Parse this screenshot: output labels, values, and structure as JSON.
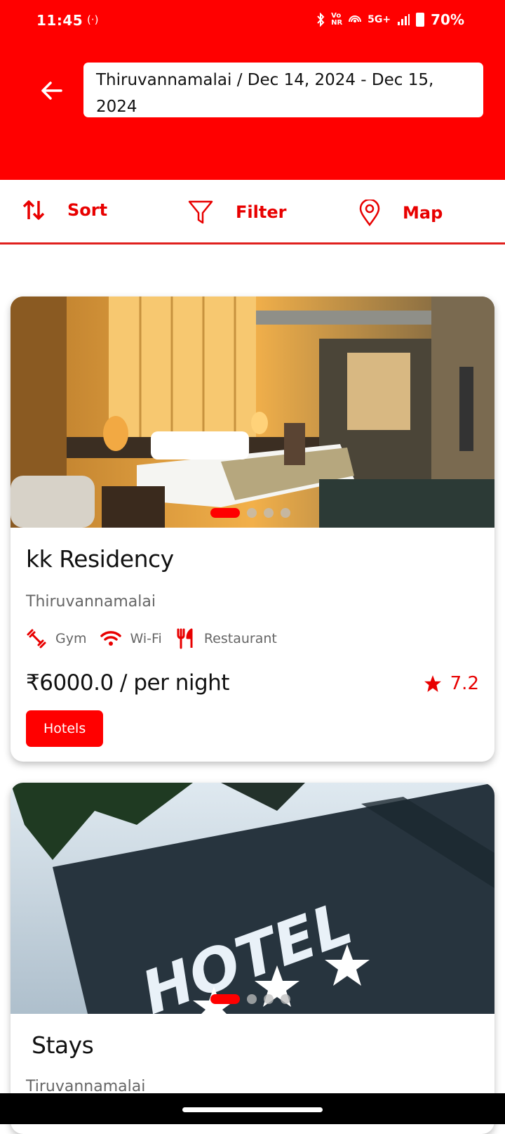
{
  "status_bar": {
    "time": "11:45",
    "network": "5G+",
    "volte": "Vo NR",
    "battery": "70%"
  },
  "header": {
    "search_text": "Thiruvannamalai / Dec 14, 2024 - Dec 15, 2024"
  },
  "toolbar": {
    "sort_label": "Sort",
    "filter_label": "Filter",
    "map_label": "Map"
  },
  "listings": [
    {
      "name": "kk Residency",
      "location": "Thiruvannamalai",
      "amenities": [
        "Gym",
        "Wi-Fi",
        "Restaurant"
      ],
      "price": "₹6000.0 / per night",
      "rating": "7.2",
      "tag": "Hotels",
      "photo_icon": "hotel-room-photo",
      "photo_text": ""
    },
    {
      "name": "Stays",
      "location": "Tiruvannamalai",
      "photo_icon": "hotel-sign-photo",
      "photo_text": "HOTEL"
    }
  ],
  "colors": {
    "brand": "#ff0000",
    "accent": "#e80000"
  }
}
